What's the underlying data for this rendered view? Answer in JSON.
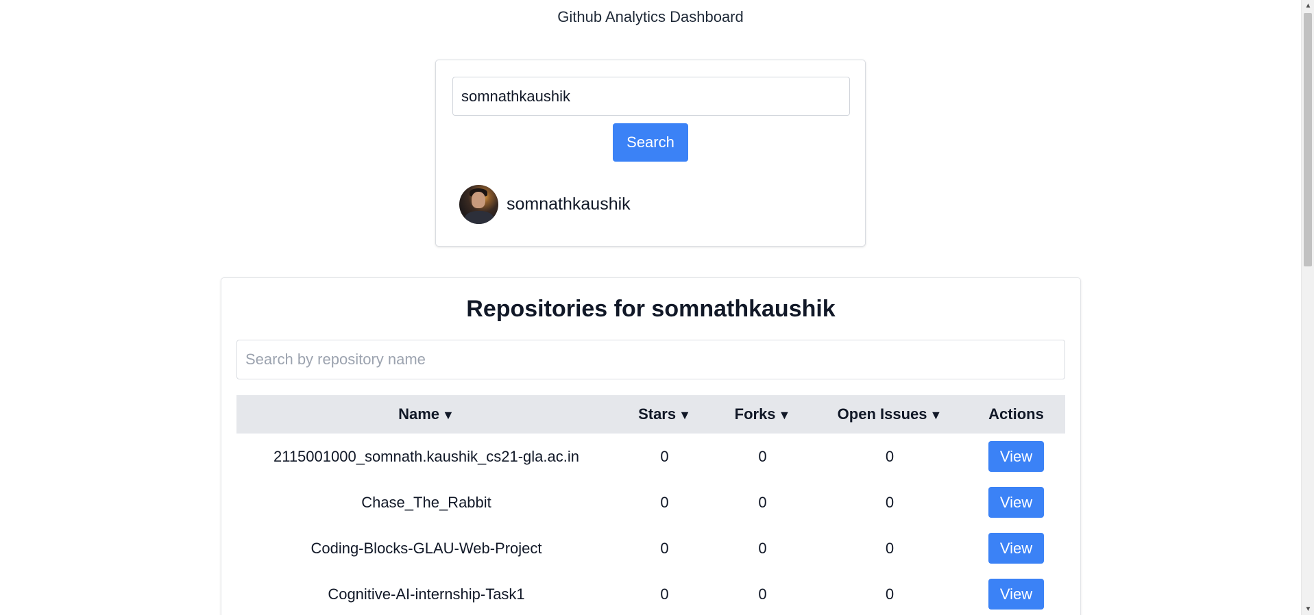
{
  "app": {
    "title": "Github Analytics Dashboard"
  },
  "search": {
    "value": "somnathkaushik",
    "button_label": "Search"
  },
  "user": {
    "username": "somnathkaushik",
    "avatar_alt": "somnathkaushik"
  },
  "repos": {
    "heading": "Repositories for somnathkaushik",
    "filter_placeholder": "Search by repository name",
    "columns": [
      {
        "label": "Name",
        "sort_icon": "▼"
      },
      {
        "label": "Stars",
        "sort_icon": "▼"
      },
      {
        "label": "Forks",
        "sort_icon": "▼"
      },
      {
        "label": "Open Issues",
        "sort_icon": "▼"
      },
      {
        "label": "Actions"
      }
    ],
    "rows": [
      {
        "name": "2115001000_somnath.kaushik_cs21-gla.ac.in",
        "stars": "0",
        "forks": "0",
        "issues": "0",
        "action": "View"
      },
      {
        "name": "Chase_The_Rabbit",
        "stars": "0",
        "forks": "0",
        "issues": "0",
        "action": "View"
      },
      {
        "name": "Coding-Blocks-GLAU-Web-Project",
        "stars": "0",
        "forks": "0",
        "issues": "0",
        "action": "View"
      },
      {
        "name": "Cognitive-AI-internship-Task1",
        "stars": "0",
        "forks": "0",
        "issues": "0",
        "action": "View"
      }
    ]
  },
  "colors": {
    "accent": "#3b82f6",
    "header_bg": "#e5e7eb"
  },
  "icons": {
    "sort": "sort-down-icon"
  }
}
